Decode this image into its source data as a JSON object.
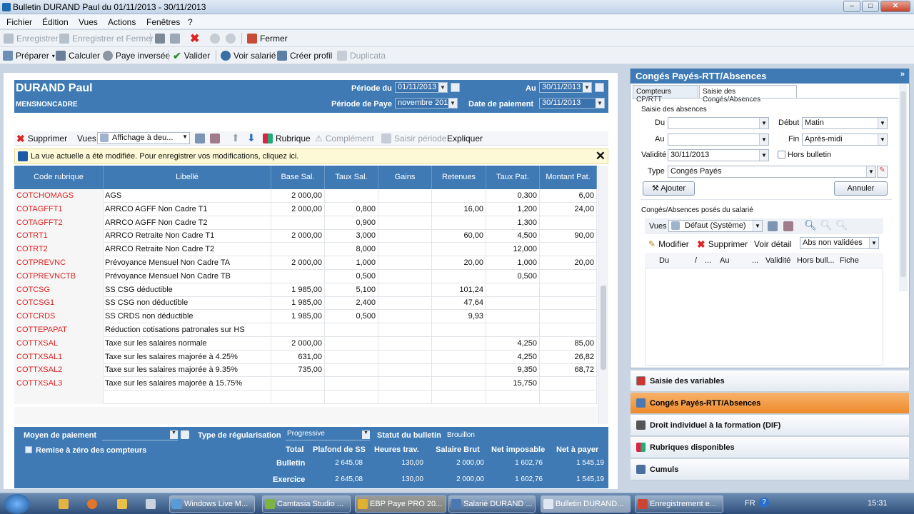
{
  "window": {
    "title": "Bulletin DURAND Paul du 01/11/2013 - 30/11/2013"
  },
  "menu": [
    "Fichier",
    "Édition",
    "Vues",
    "Actions",
    "Fenêtres",
    "?"
  ],
  "toolbar1": {
    "save": "Enregistrer",
    "save_close": "Enregistrer et Fermer",
    "close": "Fermer"
  },
  "toolbar2": {
    "prepare": "Préparer",
    "calculate": "Calculer",
    "reverse": "Paye inversée",
    "validate": "Valider",
    "view_employee": "Voir salarié",
    "create_profile": "Créer profil",
    "duplicate": "Duplicata"
  },
  "header": {
    "name": "DURAND Paul",
    "profile": "MENSNONCADRE",
    "period_from_label": "Période du",
    "period_from": "01/11/2013",
    "period_to_label": "Au",
    "period_to": "30/11/2013",
    "pay_period_label": "Période de Paye",
    "pay_period": "novembre 2013",
    "pay_date_label": "Date de paiement",
    "pay_date": "30/11/2013"
  },
  "gridtoolbar": {
    "delete": "Supprimer",
    "views": "Vues",
    "display": "Affichage à deu...",
    "rubrique": "Rubrique",
    "complement": "Complément",
    "input_period": "Saisir période",
    "explain": "Expliquer"
  },
  "notice": "La vue actuelle a été modifiée. Pour enregistrer vos modifications, cliquez ici.",
  "grid": {
    "headers": [
      "Code rubrique",
      "Libellé",
      "Base Sal.",
      "Taux Sal.",
      "Gains",
      "Retenues",
      "Taux Pat.",
      "Montant Pat."
    ],
    "rows": [
      [
        "COTCHOMAGS",
        "AGS",
        "2 000,00",
        "",
        "",
        "",
        "0,300",
        "6,00"
      ],
      [
        "COTAGFFT1",
        "ARRCO AGFF Non Cadre T1",
        "2 000,00",
        "0,800",
        "",
        "16,00",
        "1,200",
        "24,00"
      ],
      [
        "COTAGFFT2",
        "ARRCO AGFF Non Cadre T2",
        "",
        "0,900",
        "",
        "",
        "1,300",
        ""
      ],
      [
        "COTRT1",
        "ARRCO Retraite Non Cadre T1",
        "2 000,00",
        "3,000",
        "",
        "60,00",
        "4,500",
        "90,00"
      ],
      [
        "COTRT2",
        "ARRCO Retraite Non Cadre T2",
        "",
        "8,000",
        "",
        "",
        "12,000",
        ""
      ],
      [
        "COTPREVNC",
        "Prévoyance Mensuel Non Cadre TA",
        "2 000,00",
        "1,000",
        "",
        "20,00",
        "1,000",
        "20,00"
      ],
      [
        "COTPREVNCTB",
        "Prévoyance Mensuel Non Cadre TB",
        "",
        "0,500",
        "",
        "",
        "0,500",
        ""
      ],
      [
        "COTCSG",
        "SS CSG déductible",
        "1 985,00",
        "5,100",
        "",
        "101,24",
        "",
        ""
      ],
      [
        "COTCSG1",
        "SS CSG non déductible",
        "1 985,00",
        "2,400",
        "",
        "47,64",
        "",
        ""
      ],
      [
        "COTCRDS",
        "SS CRDS non déductible",
        "1 985,00",
        "0,500",
        "",
        "9,93",
        "",
        ""
      ],
      [
        "COTTEPAPAT",
        "Réduction cotisations patronales sur HS",
        "",
        "",
        "",
        "",
        "",
        ""
      ],
      [
        "COTTXSAL",
        "Taxe sur les salaires normale",
        "2 000,00",
        "",
        "",
        "",
        "4,250",
        "85,00"
      ],
      [
        "COTTXSAL1",
        "Taxe sur les salaires majorée à 4.25%",
        "631,00",
        "",
        "",
        "",
        "4,250",
        "26,82"
      ],
      [
        "COTTXSAL2",
        "Taxe sur les salaires majorée à 9.35%",
        "735,00",
        "",
        "",
        "",
        "9,350",
        "68,72"
      ],
      [
        "COTTXSAL3",
        "Taxe sur les salaires majorée à 15.75%",
        "",
        "",
        "",
        "",
        "15,750",
        ""
      ],
      [
        "",
        "",
        "",
        "",
        "",
        "",
        "",
        ""
      ]
    ]
  },
  "footer": {
    "payment_label": "Moyen de paiement",
    "regul_label": "Type de régularisation",
    "regul_value": "Progressive",
    "status_label": "Statut du bulletin",
    "status_value": "Brouillon",
    "reset_label": "Remise à zéro des compteurs",
    "cols": [
      "Total",
      "Plafond de SS",
      "Heures trav.",
      "Salaire Brut",
      "Net imposable",
      "Net à payer"
    ],
    "bulletin": [
      "Bulletin",
      "2 645,08",
      "130,00",
      "2 000,00",
      "1 602,76",
      "1 545,19"
    ],
    "exercice": [
      "Exercice",
      "2 645,08",
      "130,00",
      "2 000,00",
      "1 602,76",
      "1 545,19"
    ]
  },
  "right": {
    "title": "Congés Payés-RTT/Absences",
    "tab1": "Compteurs CP/RTT",
    "tab2": "Saisie des Congés/Absences",
    "section": "Saisie des absences",
    "du": "Du",
    "au": "Au",
    "debut": "Début",
    "debut_val": "Matin",
    "fin": "Fin",
    "fin_val": "Après-midi",
    "validite": "Validité",
    "validite_val": "30/11/2013",
    "hors": "Hors bulletin",
    "type": "Type",
    "type_val": "Congés Payés",
    "add": "Ajouter",
    "cancel": "Annuler",
    "list_title": "Congés/Absences posés du salarié",
    "views": "Vues",
    "views_val": "Défaut (Système)",
    "modify": "Modifier",
    "delete": "Supprimer",
    "detail": "Voir détail",
    "filter": "Abs non validées",
    "cols": [
      "Du",
      "/",
      "...",
      "Au",
      "...",
      "Validité",
      "Hors bull...",
      "Fiche"
    ]
  },
  "accordion": [
    "Saisie des variables",
    "Congés Payés-RTT/Absences",
    "Droit individuel à la formation (DIF)",
    "Rubriques disponibles",
    "Cumuls"
  ],
  "taskbar": {
    "items": [
      "Windows Live M...",
      "Camtasia Studio ...",
      "EBP Paye PRO 20...",
      "Salarié DURAND ...",
      "Bulletin DURAND...",
      "Enregistrement e..."
    ],
    "lang": "FR",
    "time": "15:31"
  }
}
